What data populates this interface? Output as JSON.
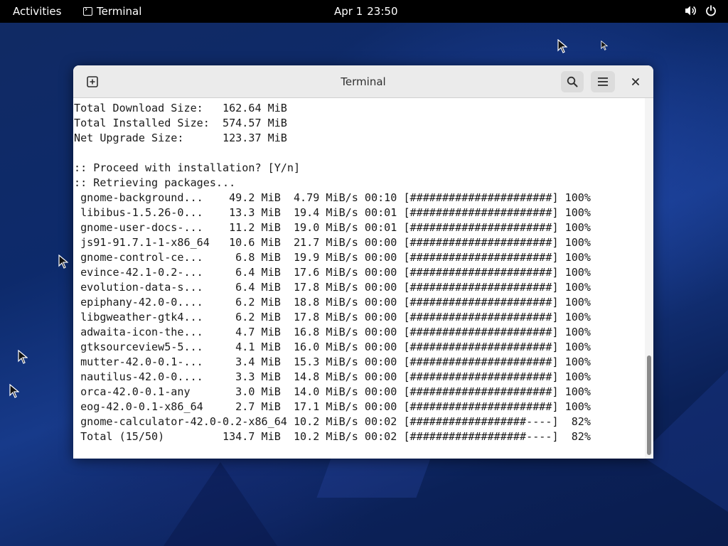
{
  "topbar": {
    "activities": "Activities",
    "app_name": "Terminal",
    "date": "Apr 1",
    "time": "23:50",
    "icons": [
      "volume-icon",
      "power-icon"
    ]
  },
  "window": {
    "title": "Terminal",
    "buttons": [
      "new-tab-icon",
      "search-icon",
      "hamburger-menu-icon",
      "close-icon"
    ]
  },
  "terminal": {
    "lines": [
      "Total Download Size:   162.64 MiB",
      "Total Installed Size:  574.57 MiB",
      "Net Upgrade Size:      123.37 MiB",
      "",
      ":: Proceed with installation? [Y/n]",
      ":: Retrieving packages...",
      " gnome-background...    49.2 MiB  4.79 MiB/s 00:10 [######################] 100%",
      " libibus-1.5.26-0...    13.3 MiB  19.4 MiB/s 00:01 [######################] 100%",
      " gnome-user-docs-...    11.2 MiB  19.0 MiB/s 00:01 [######################] 100%",
      " js91-91.7.1-1-x86_64   10.6 MiB  21.7 MiB/s 00:00 [######################] 100%",
      " gnome-control-ce...     6.8 MiB  19.9 MiB/s 00:00 [######################] 100%",
      " evince-42.1-0.2-...     6.4 MiB  17.6 MiB/s 00:00 [######################] 100%",
      " evolution-data-s...     6.4 MiB  17.8 MiB/s 00:00 [######################] 100%",
      " epiphany-42.0-0....     6.2 MiB  18.8 MiB/s 00:00 [######################] 100%",
      " libgweather-gtk4...     6.2 MiB  17.8 MiB/s 00:00 [######################] 100%",
      " adwaita-icon-the...     4.7 MiB  16.8 MiB/s 00:00 [######################] 100%",
      " gtksourceview5-5...     4.1 MiB  16.0 MiB/s 00:00 [######################] 100%",
      " mutter-42.0-0.1-...     3.4 MiB  15.3 MiB/s 00:00 [######################] 100%",
      " nautilus-42.0-0....     3.3 MiB  14.8 MiB/s 00:00 [######################] 100%",
      " orca-42.0-0.1-any       3.0 MiB  14.0 MiB/s 00:00 [######################] 100%",
      " eog-42.0-0.1-x86_64     2.7 MiB  17.1 MiB/s 00:00 [######################] 100%",
      " gnome-calculator-42.0-0.2-x86_64 10.2 MiB/s 00:02 [##################----]  82%",
      " Total (15/50)         134.7 MiB  10.2 MiB/s 00:02 [##################----]  82%"
    ],
    "scroll_position": 0.72
  }
}
